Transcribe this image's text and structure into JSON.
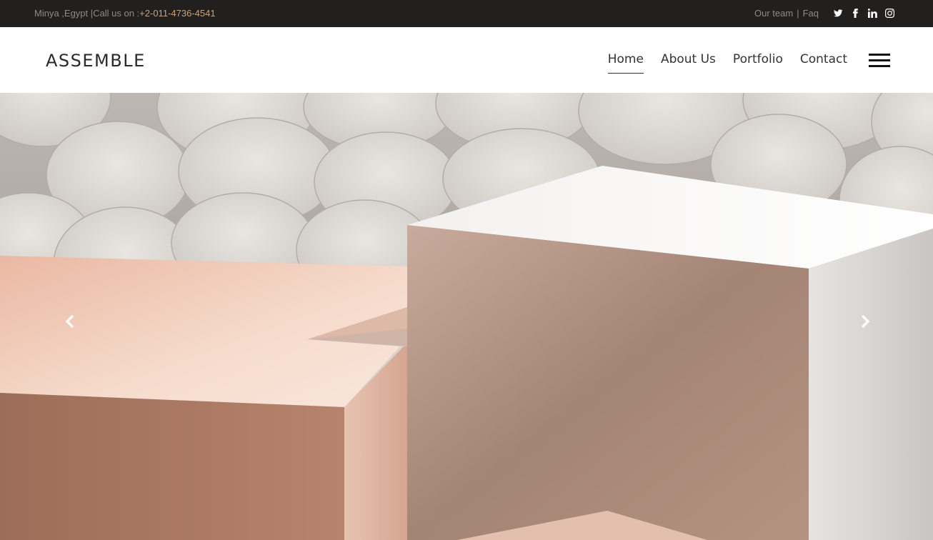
{
  "topbar": {
    "location": "Minya ,Egypt |Call us on :",
    "phone": "+2-011-4736-4541",
    "links": {
      "team": "Our team",
      "separator": "|",
      "faq": "Faq"
    },
    "social": [
      "twitter-icon",
      "facebook-icon",
      "linkedin-icon",
      "instagram-icon"
    ]
  },
  "header": {
    "logo": "ASSEMBLE",
    "nav": [
      {
        "label": "Home",
        "active": true
      },
      {
        "label": "About Us",
        "active": false
      },
      {
        "label": "Portfolio",
        "active": false
      },
      {
        "label": "Contact",
        "active": false
      }
    ],
    "menu_icon": "hamburger-icon"
  },
  "hero": {
    "prev_icon": "chevron-left-icon",
    "next_icon": "chevron-right-icon"
  },
  "colors": {
    "topbar_bg": "#221f1f",
    "phone_accent": "#c9a27e",
    "nav_text": "#333333"
  }
}
